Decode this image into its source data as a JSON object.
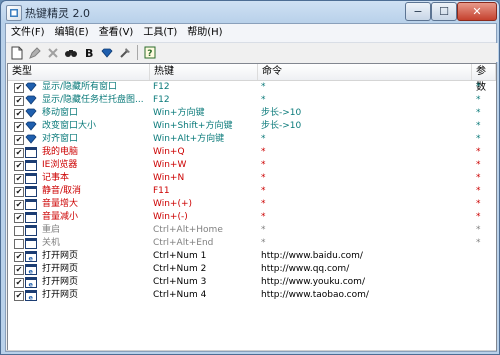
{
  "window": {
    "title": "热键精灵 2.0"
  },
  "titlebar": {
    "min": "−",
    "max": "☐",
    "close": "✕"
  },
  "menu": [
    {
      "label": "文件(F)"
    },
    {
      "label": "编辑(E)"
    },
    {
      "label": "查看(V)"
    },
    {
      "label": "工具(T)"
    },
    {
      "label": "帮助(H)"
    }
  ],
  "toolbar": [
    {
      "icon": "new-document-icon"
    },
    {
      "icon": "edit-icon"
    },
    {
      "icon": "delete-icon"
    },
    {
      "icon": "find-icon"
    },
    {
      "icon": "bold-icon"
    },
    {
      "icon": "gem-icon"
    },
    {
      "icon": "tools-icon"
    },
    {
      "icon": "help-icon"
    }
  ],
  "columns": [
    "类型",
    "热键",
    "命令",
    "参数"
  ],
  "colors": {
    "teal": "#0a7a7a",
    "red": "#cc0000",
    "gray": "#808080",
    "black": "#000000",
    "accent": "#3c7fc0"
  },
  "rows": [
    {
      "checked": true,
      "icon": "gem-icon",
      "type": "显示/隐藏所有窗口",
      "hotkey": "F12",
      "command": "*",
      "param": "*",
      "color": "#0a7a7a"
    },
    {
      "checked": true,
      "icon": "gem-icon",
      "type": "显示/隐藏任务栏托盘图...",
      "hotkey": "F12",
      "command": "*",
      "param": "*",
      "color": "#0a7a7a"
    },
    {
      "checked": true,
      "icon": "gem-icon",
      "type": "移动窗口",
      "hotkey": "Win+方向键",
      "command": "步长->10",
      "param": "*",
      "color": "#0a7a7a"
    },
    {
      "checked": true,
      "icon": "gem-icon",
      "type": "改变窗口大小",
      "hotkey": "Win+Shift+方向键",
      "command": "步长->10",
      "param": "*",
      "color": "#0a7a7a"
    },
    {
      "checked": true,
      "icon": "gem-icon",
      "type": "对齐窗口",
      "hotkey": "Win+Alt+方向键",
      "command": "*",
      "param": "*",
      "color": "#0a7a7a"
    },
    {
      "checked": true,
      "icon": "window-icon",
      "type": "我的电脑",
      "hotkey": "Win+Q",
      "command": "*",
      "param": "*",
      "color": "#cc0000"
    },
    {
      "checked": true,
      "icon": "window-icon",
      "type": "IE浏览器",
      "hotkey": "Win+W",
      "command": "*",
      "param": "*",
      "color": "#cc0000"
    },
    {
      "checked": true,
      "icon": "window-icon",
      "type": "记事本",
      "hotkey": "Win+N",
      "command": "*",
      "param": "*",
      "color": "#cc0000"
    },
    {
      "checked": true,
      "icon": "window-icon",
      "type": "静音/取消",
      "hotkey": "F11",
      "command": "*",
      "param": "*",
      "color": "#cc0000"
    },
    {
      "checked": true,
      "icon": "window-icon",
      "type": "音量增大",
      "hotkey": "Win+(+)",
      "command": "*",
      "param": "*",
      "color": "#cc0000"
    },
    {
      "checked": true,
      "icon": "window-icon",
      "type": "音量减小",
      "hotkey": "Win+(-)",
      "command": "*",
      "param": "*",
      "color": "#cc0000"
    },
    {
      "checked": false,
      "icon": "window-icon",
      "type": "重启",
      "hotkey": "Ctrl+Alt+Home",
      "command": "*",
      "param": "*",
      "color": "#808080"
    },
    {
      "checked": false,
      "icon": "window-icon",
      "type": "关机",
      "hotkey": "Ctrl+Alt+End",
      "command": "*",
      "param": "*",
      "color": "#808080"
    },
    {
      "checked": true,
      "icon": "ie-icon",
      "type": "打开网页",
      "hotkey": "Ctrl+Num 1",
      "command": "http://www.baidu.com/",
      "param": "",
      "color": "#000000"
    },
    {
      "checked": true,
      "icon": "ie-icon",
      "type": "打开网页",
      "hotkey": "Ctrl+Num 2",
      "command": "http://www.qq.com/",
      "param": "",
      "color": "#000000"
    },
    {
      "checked": true,
      "icon": "ie-icon",
      "type": "打开网页",
      "hotkey": "Ctrl+Num 3",
      "command": "http://www.youku.com/",
      "param": "",
      "color": "#000000"
    },
    {
      "checked": true,
      "icon": "ie-icon",
      "type": "打开网页",
      "hotkey": "Ctrl+Num 4",
      "command": "http://www.taobao.com/",
      "param": "",
      "color": "#000000"
    }
  ]
}
